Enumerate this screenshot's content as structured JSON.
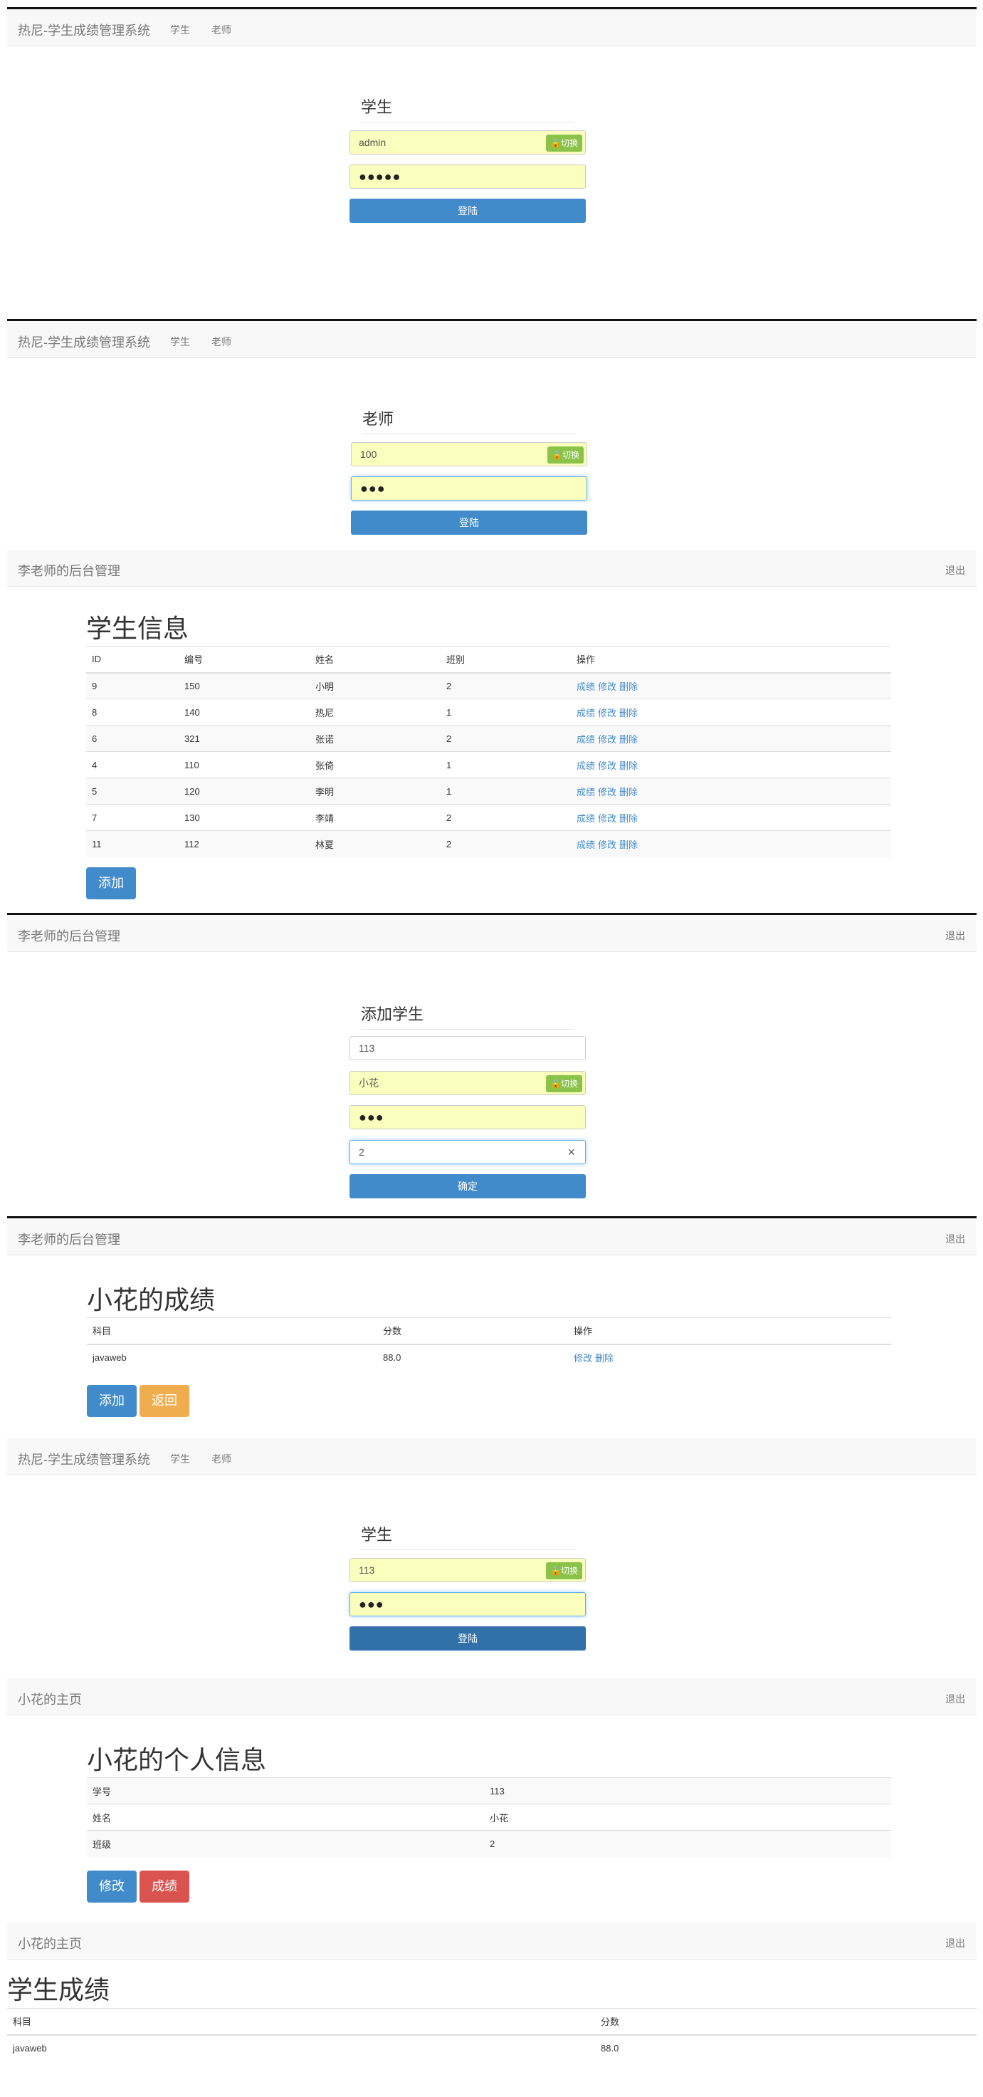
{
  "s1": {
    "brand": "热尼-学生成绩管理系统",
    "nav_student": "学生",
    "nav_teacher": "老师",
    "form_title": "学生",
    "username": "admin",
    "password": "●●●●●",
    "switch_label": "切换",
    "login": "登陆"
  },
  "s2": {
    "brand": "热尼-学生成绩管理系统",
    "nav_student": "学生",
    "nav_teacher": "老师",
    "form_title": "老师",
    "username": "100",
    "password": "●●●",
    "switch_label": "切换",
    "login": "登陆"
  },
  "s3": {
    "brand": "李老师的后台管理",
    "logout": "退出",
    "heading": "学生信息",
    "columns": [
      "ID",
      "编号",
      "姓名",
      "班别",
      "操作"
    ],
    "rows": [
      [
        "9",
        "150",
        "小明",
        "2"
      ],
      [
        "8",
        "140",
        "热尼",
        "1"
      ],
      [
        "6",
        "321",
        "张诺",
        "2"
      ],
      [
        "4",
        "110",
        "张倚",
        "1"
      ],
      [
        "5",
        "120",
        "李明",
        "1"
      ],
      [
        "7",
        "130",
        "李靖",
        "2"
      ],
      [
        "11",
        "112",
        "林夏",
        "2"
      ]
    ],
    "actions": [
      "成绩",
      "修改",
      "删除"
    ],
    "add": "添加"
  },
  "s4": {
    "brand": "李老师的后台管理",
    "logout": "退出",
    "form_title": "添加学生",
    "number": "113",
    "name": "小花",
    "password": "●●●",
    "class_no": "2",
    "switch_label": "切换",
    "confirm": "确定"
  },
  "s5": {
    "brand": "李老师的后台管理",
    "logout": "退出",
    "heading": "小花的成绩",
    "columns": [
      "科目",
      "分数",
      "操作"
    ],
    "rows": [
      [
        "javaweb",
        "88.0"
      ]
    ],
    "actions": [
      "修改",
      "删除"
    ],
    "add": "添加",
    "back": "返回"
  },
  "s6": {
    "brand": "热尼-学生成绩管理系统",
    "nav_student": "学生",
    "nav_teacher": "老师",
    "form_title": "学生",
    "username": "113",
    "password": "●●●",
    "switch_label": "切换",
    "login": "登陆"
  },
  "s7": {
    "brand": "小花的主页",
    "logout": "退出",
    "heading": "小花的个人信息",
    "rows": [
      [
        "学号",
        "113"
      ],
      [
        "姓名",
        "小花"
      ],
      [
        "班级",
        "2"
      ]
    ],
    "edit": "修改",
    "scores": "成绩"
  },
  "s8": {
    "brand": "小花的主页",
    "logout": "退出",
    "heading": "学生成绩",
    "columns": [
      "科目",
      "分数"
    ],
    "rows": [
      [
        "javaweb",
        "88.0"
      ]
    ]
  },
  "colors": {
    "primary": "#428bca",
    "warning": "#f0ad4e",
    "danger": "#d9534f",
    "autofill": "#faffbd",
    "switch": "#8bc34a"
  },
  "icons": {
    "switch": "lock-icon",
    "clear": "close-icon"
  }
}
